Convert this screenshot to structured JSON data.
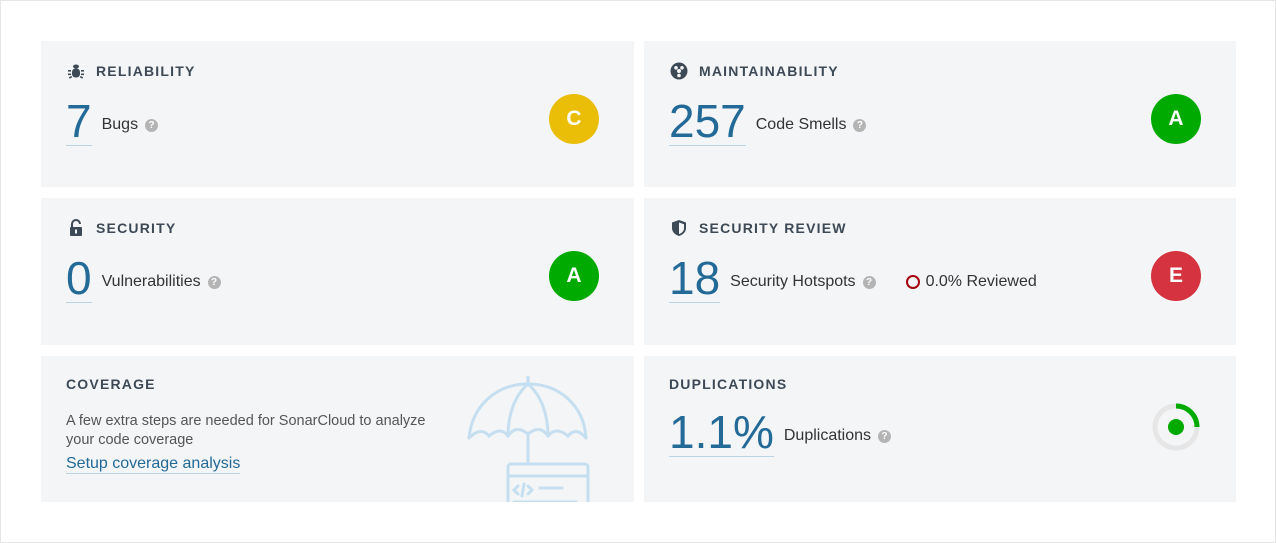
{
  "reliability": {
    "title": "RELIABILITY",
    "icon": "bug-icon",
    "value": "7",
    "label": "Bugs",
    "rating": "C",
    "rating_color": "#eabe06"
  },
  "maintainability": {
    "title": "MAINTAINABILITY",
    "icon": "maintainability-icon",
    "value": "257",
    "label": "Code Smells",
    "rating": "A",
    "rating_color": "#00aa00"
  },
  "security": {
    "title": "SECURITY",
    "icon": "unlock-icon",
    "value": "0",
    "label": "Vulnerabilities",
    "rating": "A",
    "rating_color": "#00aa00"
  },
  "security_review": {
    "title": "SECURITY REVIEW",
    "icon": "shield-icon",
    "value": "18",
    "label": "Security Hotspots",
    "reviewed": "0.0% Reviewed",
    "rating": "E",
    "rating_color": "#d4333f"
  },
  "coverage": {
    "title": "COVERAGE",
    "message": "A few extra steps are needed for SonarCloud to analyze your code coverage",
    "link": "Setup coverage analysis"
  },
  "duplications": {
    "title": "DUPLICATIONS",
    "value": "1.1%",
    "label": "Duplications",
    "ring_fraction": 0.011
  },
  "help_glyph": "?"
}
